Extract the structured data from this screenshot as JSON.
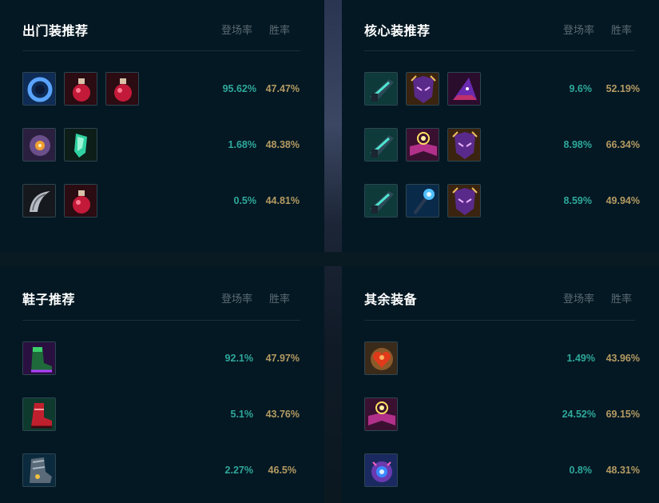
{
  "headers": {
    "pick_rate": "登场率",
    "win_rate": "胜率"
  },
  "panels": {
    "starter": {
      "title": "出门装推荐",
      "rows": [
        {
          "items": [
            "dark-seal-icon",
            "health-potion-icon",
            "health-potion-icon"
          ],
          "pick": "95.62%",
          "win": "47.47%"
        },
        {
          "items": [
            "tear-icon",
            "refillable-potion-icon"
          ],
          "pick": "1.68%",
          "win": "48.38%"
        },
        {
          "items": [
            "scythe-icon",
            "health-potion-icon"
          ],
          "pick": "0.5%",
          "win": "44.81%"
        }
      ]
    },
    "core": {
      "title": "核心装推荐",
      "rows": [
        {
          "items": [
            "hextech-gunblade-icon",
            "void-mask-icon",
            "rabadon-hat-icon"
          ],
          "pick": "9.6%",
          "win": "52.19%"
        },
        {
          "items": [
            "hextech-gunblade-icon",
            "spellbook-icon",
            "void-mask-icon"
          ],
          "pick": "8.98%",
          "win": "66.34%"
        },
        {
          "items": [
            "hextech-gunblade-icon",
            "crystal-staff-icon",
            "void-mask-icon"
          ],
          "pick": "8.59%",
          "win": "49.94%"
        }
      ]
    },
    "boots": {
      "title": "鞋子推荐",
      "rows": [
        {
          "items": [
            "sorcerer-boots-icon"
          ],
          "pick": "92.1%",
          "win": "47.97%"
        },
        {
          "items": [
            "mercury-boots-icon"
          ],
          "pick": "5.1%",
          "win": "43.76%"
        },
        {
          "items": [
            "plated-boots-icon"
          ],
          "pick": "2.27%",
          "win": "46.5%"
        }
      ]
    },
    "others": {
      "title": "其余装备",
      "rows": [
        {
          "items": [
            "sunfire-heart-icon"
          ],
          "pick": "1.49%",
          "win": "43.96%"
        },
        {
          "items": [
            "spellbook-icon"
          ],
          "pick": "24.52%",
          "win": "69.15%"
        },
        {
          "items": [
            "void-orb-icon"
          ],
          "pick": "0.8%",
          "win": "48.31%"
        }
      ]
    }
  }
}
